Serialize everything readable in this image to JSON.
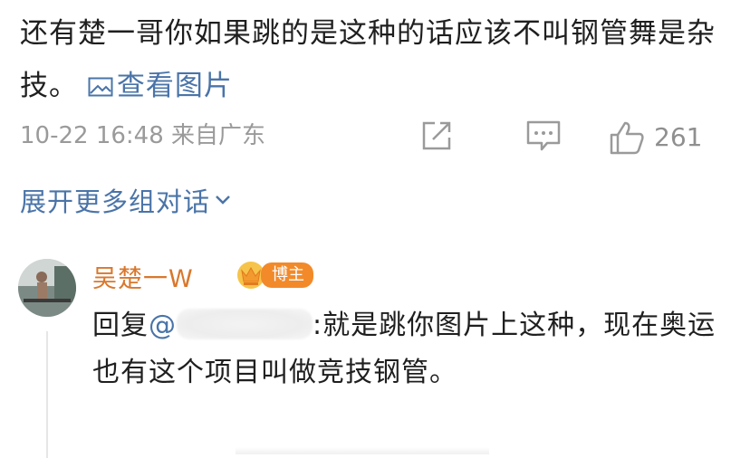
{
  "comment": {
    "text": "还有楚一哥你如果跳的是这种的话应该不叫钢管舞是杂技。",
    "view_image_label": "查看图片",
    "view_image_icon": "image-icon",
    "timestamp": "10-22 16:48",
    "location": "来自广东",
    "like_count": "261",
    "icons": [
      "share-icon",
      "comment-icon",
      "like-icon"
    ]
  },
  "expand": {
    "label": "展开更多组对话",
    "icon": "chevron-down-icon"
  },
  "reply": {
    "author": "吴楚一W",
    "badge_label": "博主",
    "prefix": "回复",
    "mention_at": "@",
    "mention_tail": "",
    "text": "就是跳你图片上这种，现在奥运也有这个项目叫做竞技钢管。"
  },
  "colors": {
    "link": "#4a74a8",
    "author": "#d9772c",
    "badge": "#f28a2a",
    "meta": "#9a9a9a"
  }
}
